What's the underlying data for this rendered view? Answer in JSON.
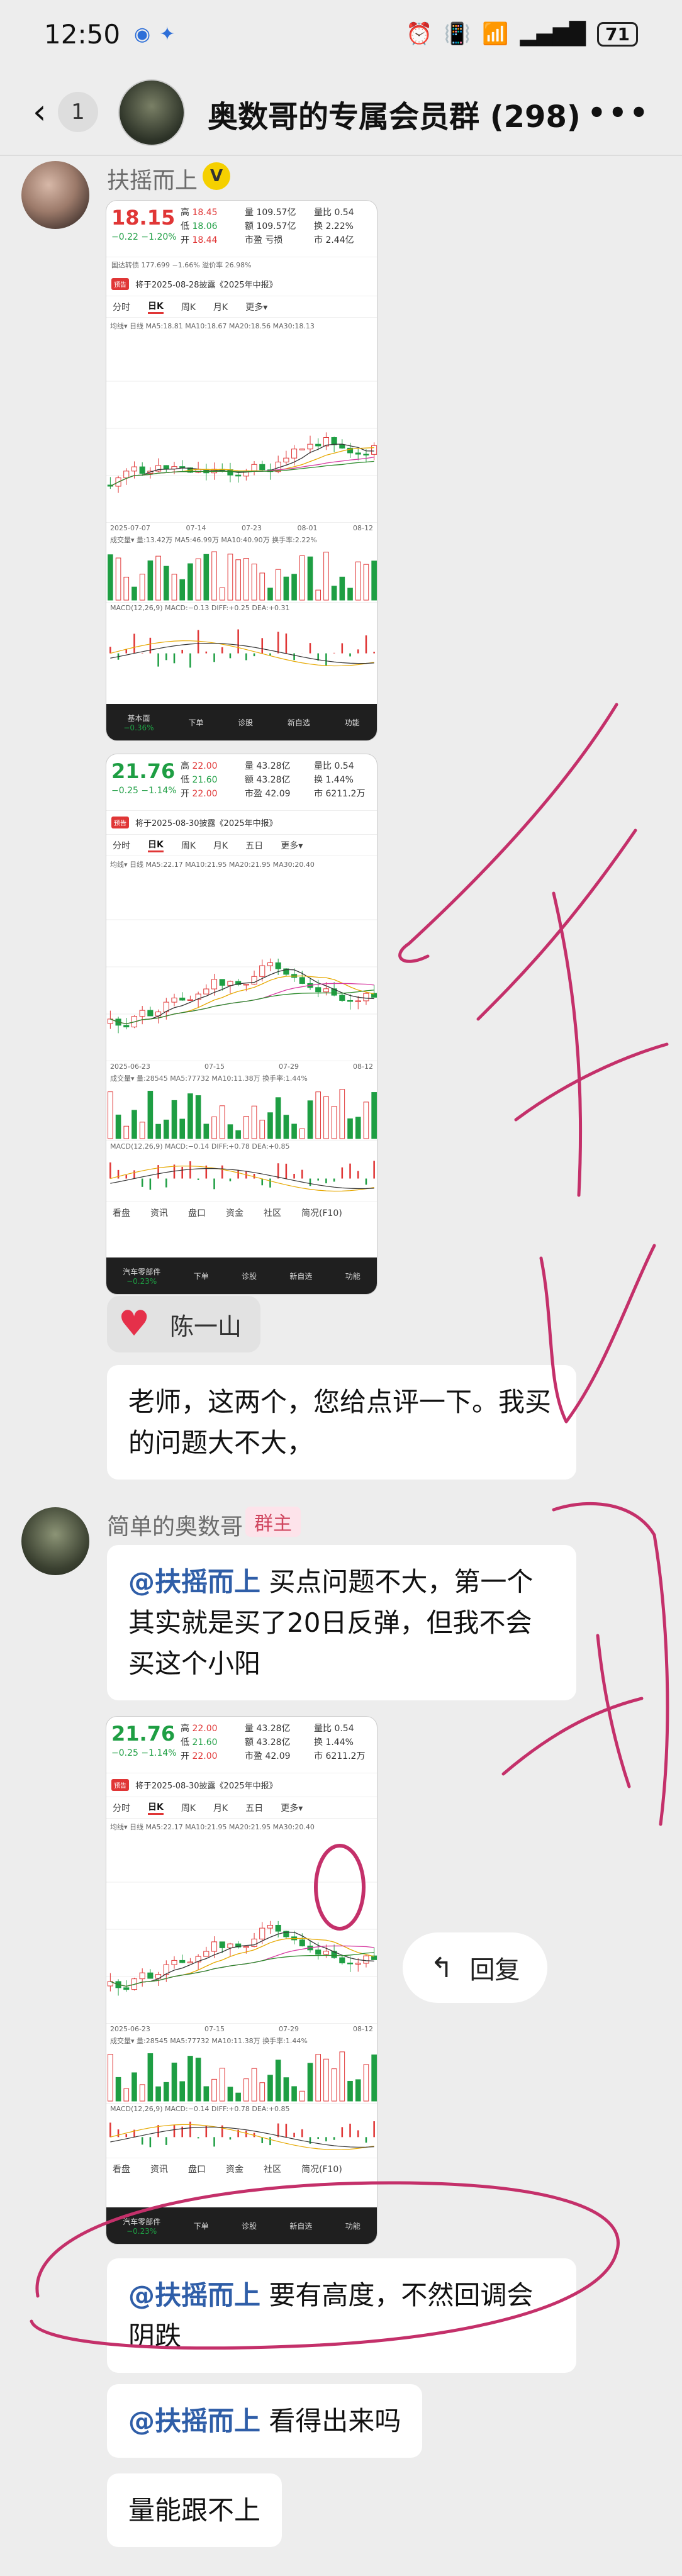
{
  "status_bar": {
    "time": "12:50",
    "battery": "71"
  },
  "header": {
    "unread_count": "1",
    "title": "奥数哥的专属会员群 (298)"
  },
  "messages": [
    {
      "sender": "扶摇而上",
      "badge": "V"
    },
    {
      "sender": "陈一山",
      "reaction": "heart"
    },
    {
      "text": "老师，这两个，您给点评一下。我买的问题大不大，"
    },
    {
      "sender": "简单的奥数哥",
      "role": "群主",
      "mention": "@扶摇而上",
      "text": " 买点问题不大，第一个其实就是买了20日反弹，但我不会买这个小阳"
    },
    {
      "reply_button": "回复"
    },
    {
      "mention": "@扶摇而上",
      "text": " 要有高度，不然回调会阴跌"
    },
    {
      "mention": "@扶摇而上",
      "text": " 看得出来吗"
    },
    {
      "text": "量能跟不上"
    }
  ],
  "stock1": {
    "price": "18.15",
    "change": "−0.22  −1.20%",
    "high": "18.45",
    "vol": "109.57亿",
    "ratio": "0.54",
    "low": "18.06",
    "amount": "109.57亿",
    "turn": "2.22%",
    "open": "18.44",
    "pe": "亏损",
    "cap": "2.44亿",
    "extra": "国达转债  177.699  −1.66%    溢价率  26.98%",
    "notice": "将于2025-08-28披露《2025年中报》",
    "tabs": [
      "分时",
      "日K",
      "周K",
      "月K",
      "更多▾"
    ],
    "ma": "均线▾  日线  MA5:18.81  MA10:18.67  MA20:18.56  MA30:18.13",
    "dates": [
      "2025-07-07",
      "07-14",
      "07-23",
      "08-01",
      "08-12"
    ],
    "vol_label": "成交量▾  量:13.42万  MA5:46.99万  MA10:40.90万  换手率:2.22%",
    "macd_label": "MACD(12,26,9)  MACD:−0.13  DIFF:+0.25   DEA:+0.31",
    "bottom": [
      "基本面",
      "下单",
      "诊股",
      "新自选",
      "功能"
    ],
    "bottom_sub": "−0.36%"
  },
  "stock2": {
    "price": "21.76",
    "change": "−0.25  −1.14%",
    "high": "22.00",
    "vol": "43.28亿",
    "ratio": "0.54",
    "low": "21.60",
    "amount": "43.28亿",
    "turn": "1.44%",
    "open": "22.00",
    "pe": "42.09",
    "cap": "6211.2万",
    "notice": "将于2025-08-30披露《2025年中报》",
    "tabs": [
      "分时",
      "日K",
      "周K",
      "月K",
      "五日",
      "更多▾"
    ],
    "ma": "均线▾  日线  MA5:22.17  MA10:21.95  MA20:21.95  MA30:20.40",
    "dates": [
      "2025-06-23",
      "07-15",
      "07-29",
      "08-12"
    ],
    "vol_label": "成交量▾  量:28545  MA5:77732  MA10:11.38万  换手率:1.44%",
    "macd_label": "MACD(12,26,9)  MACD:−0.14  DIFF:+0.78   DEA:+0.85",
    "lower_tabs": [
      "看盘",
      "资讯",
      "盘口",
      "资金",
      "社区",
      "简况(F10)"
    ],
    "bottom": [
      "汽车零部件",
      "下单",
      "诊股",
      "新自选",
      "功能"
    ],
    "bottom_sub": "−0.23%"
  },
  "colors": {
    "up": "#e03636",
    "down": "#1e9e43",
    "ink": "#c4306a",
    "mention": "#2f5ea8"
  }
}
